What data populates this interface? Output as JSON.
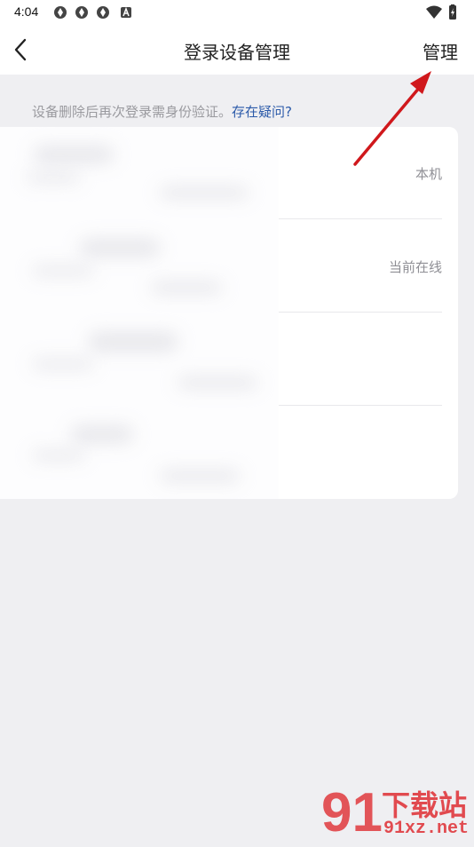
{
  "status_bar": {
    "time": "4:04"
  },
  "header": {
    "title": "登录设备管理",
    "manage_label": "管理"
  },
  "hint": {
    "text": "设备删除后再次登录需身份验证。",
    "link": "存在疑问?"
  },
  "devices": [
    {
      "tag": "本机"
    },
    {
      "tag": "当前在线"
    },
    {
      "tag": ""
    },
    {
      "tag": ""
    }
  ],
  "watermark": {
    "brand": "下载站",
    "site": "91xz.net",
    "logo_glyph": "91"
  },
  "colors": {
    "background": "#efeff2",
    "link": "#2b5aa9",
    "annotation_arrow": "#d0181c",
    "watermark_red": "#e0393e"
  }
}
